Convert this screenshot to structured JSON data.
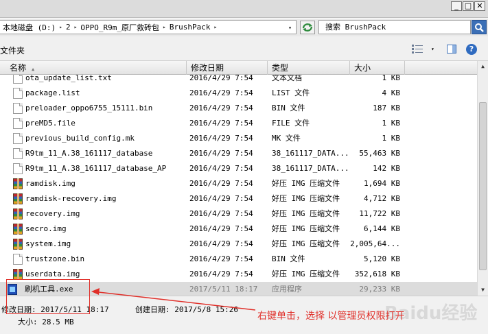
{
  "window": {
    "buttons": [
      {
        "name": "minimize-button",
        "glyph": "_"
      },
      {
        "name": "maximize-button",
        "glyph": "□"
      },
      {
        "name": "close-button",
        "glyph": "✕"
      }
    ]
  },
  "address": {
    "crumbs": [
      "本地磁盘 (D:)",
      "2",
      "OPPO_R9m_原厂救砖包",
      "BrushPack"
    ],
    "separator": "▸",
    "dropdown": "▾"
  },
  "search": {
    "placeholder": "搜索 BrushPack"
  },
  "toolbar": {
    "folder_label": "文件夹",
    "view_dropdown": "▾",
    "help": "?"
  },
  "columns": {
    "name": "名称",
    "date": "修改日期",
    "type": "类型",
    "size": "大小",
    "sort": "▲"
  },
  "files": [
    {
      "name": "ota_update_list.txt",
      "date": "2016/4/29 7:54",
      "type": "文本文档",
      "size": "1 KB",
      "icon": "doc"
    },
    {
      "name": "package.list",
      "date": "2016/4/29 7:54",
      "type": "LIST 文件",
      "size": "4 KB",
      "icon": "doc"
    },
    {
      "name": "preloader_oppo6755_15111.bin",
      "date": "2016/4/29 7:54",
      "type": "BIN 文件",
      "size": "187 KB",
      "icon": "doc"
    },
    {
      "name": "preMD5.file",
      "date": "2016/4/29 7:54",
      "type": "FILE 文件",
      "size": "1 KB",
      "icon": "doc"
    },
    {
      "name": "previous_build_config.mk",
      "date": "2016/4/29 7:54",
      "type": "MK 文件",
      "size": "1 KB",
      "icon": "doc"
    },
    {
      "name": "R9tm_11_A.38_161117_database",
      "date": "2016/4/29 7:54",
      "type": "38_161117_DATA...",
      "size": "55,463 KB",
      "icon": "doc"
    },
    {
      "name": "R9tm_11_A.38_161117_database_AP",
      "date": "2016/4/29 7:54",
      "type": "38_161117_DATA...",
      "size": "142 KB",
      "icon": "doc"
    },
    {
      "name": "ramdisk.img",
      "date": "2016/4/29 7:54",
      "type": "好压 IMG 压缩文件",
      "size": "1,694 KB",
      "icon": "rar"
    },
    {
      "name": "ramdisk-recovery.img",
      "date": "2016/4/29 7:54",
      "type": "好压 IMG 压缩文件",
      "size": "4,712 KB",
      "icon": "rar"
    },
    {
      "name": "recovery.img",
      "date": "2016/4/29 7:54",
      "type": "好压 IMG 压缩文件",
      "size": "11,722 KB",
      "icon": "rar"
    },
    {
      "name": "secro.img",
      "date": "2016/4/29 7:54",
      "type": "好压 IMG 压缩文件",
      "size": "6,144 KB",
      "icon": "rar"
    },
    {
      "name": "system.img",
      "date": "2016/4/29 7:54",
      "type": "好压 IMG 压缩文件",
      "size": "2,005,64...",
      "icon": "rar"
    },
    {
      "name": "trustzone.bin",
      "date": "2016/4/29 7:54",
      "type": "BIN 文件",
      "size": "5,120 KB",
      "icon": "doc"
    },
    {
      "name": "userdata.img",
      "date": "2016/4/29 7:54",
      "type": "好压 IMG 压缩文件",
      "size": "352,618 KB",
      "icon": "rar"
    },
    {
      "name": "刷机工具.exe",
      "date": "2017/5/11 18:17",
      "type": "应用程序",
      "size": "29,233 KB",
      "icon": "exe",
      "selected": true
    }
  ],
  "scrollbar": {
    "up": "▲",
    "down": "▼"
  },
  "details": {
    "modified": "修改日期: 2017/5/11 18:17",
    "created": "创建日期: 2017/5/8 15:26",
    "size": "大小: 28.5 MB"
  },
  "annotation": {
    "text": "右键单击，选择 以管理员权限打开",
    "color": "#e0302a"
  },
  "watermark": "Baidu经验"
}
